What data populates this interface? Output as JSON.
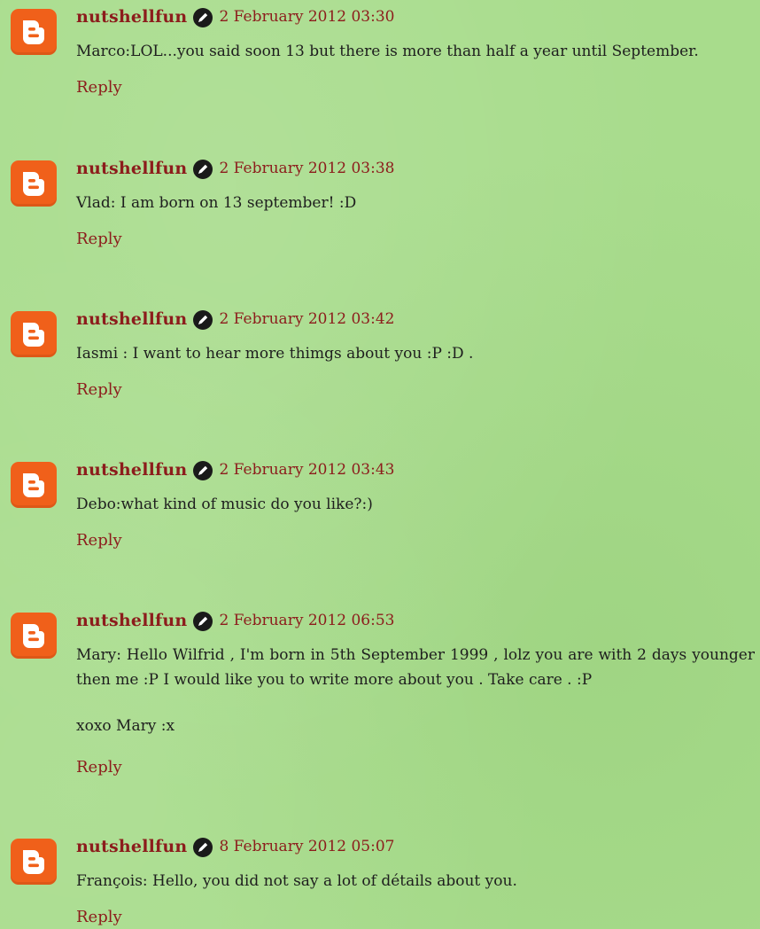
{
  "comments": [
    {
      "author": "nutshellfun",
      "timestamp": "2 February 2012 03:30",
      "paragraphs": [
        "Marco:LOL...you said soon 13 but there is more than half a year until September."
      ],
      "reply_label": "Reply"
    },
    {
      "author": "nutshellfun",
      "timestamp": "2 February 2012 03:38",
      "paragraphs": [
        "Vlad: I am born on 13 september! :D"
      ],
      "reply_label": "Reply"
    },
    {
      "author": "nutshellfun",
      "timestamp": "2 February 2012 03:42",
      "paragraphs": [
        "Iasmi : I want to hear more thimgs about you :P :D ."
      ],
      "reply_label": "Reply"
    },
    {
      "author": "nutshellfun",
      "timestamp": "2 February 2012 03:43",
      "paragraphs": [
        "Debo:what kind of music do you like?:)"
      ],
      "reply_label": "Reply"
    },
    {
      "author": "nutshellfun",
      "timestamp": "2 February 2012 06:53",
      "paragraphs": [
        "Mary: Hello Wilfrid , I'm born in 5th September 1999 , lolz you are with 2 days younger then me :P I would like you to write more about you . Take care . :P",
        "xoxo Mary :x"
      ],
      "reply_label": "Reply"
    },
    {
      "author": "nutshellfun",
      "timestamp": "8 February 2012 05:07",
      "paragraphs": [
        "François: Hello, you did not say a lot of détails about you."
      ],
      "reply_label": "Reply"
    }
  ],
  "icons": {
    "avatar": "blogger-icon",
    "edit": "pencil-edit-icon"
  },
  "colors": {
    "background": "#a8dc8c",
    "link": "#8c1c1c",
    "avatar": "#f0601a",
    "text": "#1e1e1e"
  }
}
